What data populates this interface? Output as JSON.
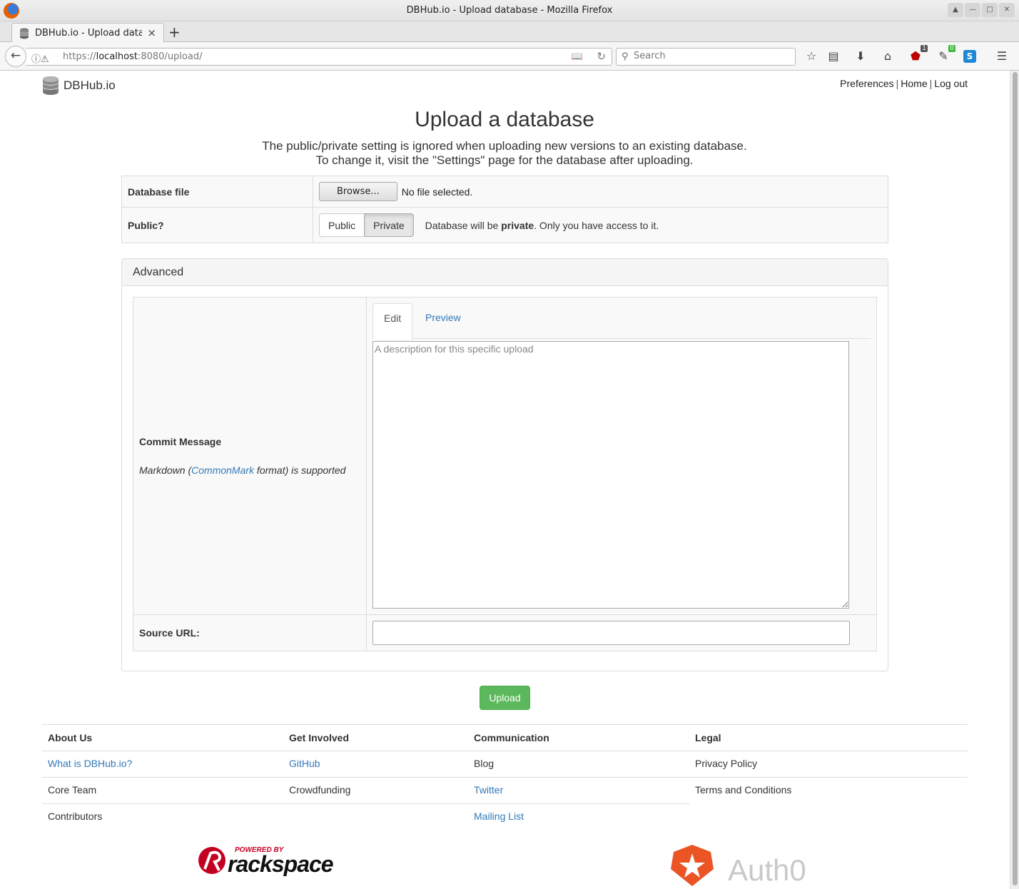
{
  "browser": {
    "window_title": "DBHub.io - Upload database - Mozilla Firefox",
    "tab_title": "DBHub.io - Upload data",
    "url_scheme": "https://",
    "url_host": "localhost",
    "url_rest": ":8080/upload/",
    "search_placeholder": "Search",
    "ublock_badge": "1",
    "ext_badge": "0",
    "accent_ublock": "#c00000",
    "accent_ext": "#3cb83c"
  },
  "header": {
    "brand": "DBHub.io",
    "nav": [
      "Preferences",
      "Home",
      "Log out"
    ]
  },
  "main": {
    "title": "Upload a database",
    "subtitle_line1": "The public/private setting is ignored when uploading new versions to an existing database.",
    "subtitle_line2": "To change it, visit the \"Settings\" page for the database after uploading.",
    "file_label": "Database file",
    "browse_label": "Browse...",
    "no_file": "No file selected.",
    "public_label": "Public?",
    "public_btn": "Public",
    "private_btn": "Private",
    "privacy_note_prefix": "Database will be ",
    "privacy_note_bold": "private",
    "privacy_note_suffix": ". Only you have access to it."
  },
  "advanced": {
    "heading": "Advanced",
    "commit_label": "Commit Message",
    "markdown_prefix": "Markdown (",
    "markdown_link": "CommonMark",
    "markdown_suffix": " format) is supported",
    "tab_edit": "Edit",
    "tab_preview": "Preview",
    "commit_placeholder": "A description for this specific upload",
    "source_label": "Source URL:",
    "source_value": ""
  },
  "upload_button": "Upload",
  "footer": {
    "about": {
      "heading": "About Us",
      "items": [
        "What is DBHub.io?",
        "Core Team",
        "Contributors"
      ]
    },
    "involved": {
      "heading": "Get Involved",
      "items": [
        "GitHub",
        "Crowdfunding"
      ]
    },
    "communication": {
      "heading": "Communication",
      "items": [
        "Blog",
        "Twitter",
        "Mailing List"
      ]
    },
    "legal": {
      "heading": "Legal",
      "items": [
        "Privacy Policy",
        "Terms and Conditions"
      ]
    }
  },
  "sponsors": {
    "rackspace_top": "POWERED BY",
    "rackspace_name": "rackspace",
    "auth0_name": "Auth0"
  },
  "colors": {
    "link": "#337ab7",
    "upload_button": "#5cb85c"
  }
}
